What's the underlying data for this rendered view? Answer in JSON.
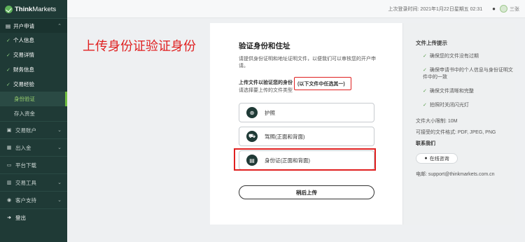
{
  "brand": {
    "name_bold": "Think",
    "name_thin": "Markets"
  },
  "topbar": {
    "last_login": "上次登录时间: 2021年1月22日星期五 02:31",
    "username": "三张"
  },
  "sidebar": {
    "open_account": "开户申请",
    "steps": [
      "个人信息",
      "交易详情",
      "财务信息",
      "交易经验"
    ],
    "leaves": [
      "身份验证",
      "存入资金"
    ],
    "main": [
      {
        "label": "交易账户",
        "icon": "trade-account-icon",
        "chev": true
      },
      {
        "label": "出入金",
        "icon": "funds-icon",
        "chev": true
      },
      {
        "label": "平台下载",
        "icon": "download-icon",
        "chev": false
      },
      {
        "label": "交易工具",
        "icon": "tools-icon",
        "chev": true
      },
      {
        "label": "客户支持",
        "icon": "support-icon",
        "chev": true
      },
      {
        "label": "登出",
        "icon": "logout-icon",
        "chev": false
      }
    ]
  },
  "annotation": "上传身份证验证身份",
  "card": {
    "title": "验证身份和住址",
    "description": "请提供身份证明和地址证明文件，以便我们可以审核您的开户申请。",
    "question": "上传文件以验证您的身份",
    "question_highlight": "(以下文件中任选其一)",
    "hint": "请选择要上传的文件类型",
    "options": [
      {
        "label": "护照",
        "icon": "globe-icon"
      },
      {
        "label": "驾照(正面和背面)",
        "icon": "car-icon"
      },
      {
        "label": "身份证(正面和背面)",
        "icon": "id-card-icon"
      }
    ],
    "later_button": "稍后上传"
  },
  "panel": {
    "title": "文件上传提示",
    "tips": [
      "确保您的文件没有过期",
      "确保申请书中的个人信息与身份证明文件中的一致",
      "确保文件清晰和完整",
      "拍照时关闭闪光灯"
    ],
    "max_size": "文件大小限制: 10M",
    "formats": "可接受的文件格式: PDF, JPEG, PNG",
    "contact": "联系我们",
    "online": "在线咨询",
    "email": "电邮: support@thinkmarkets.com.cn"
  },
  "colors": {
    "sidebar": "#1f3a36",
    "accent": "#6dbb3f",
    "highlight": "#e02020"
  }
}
